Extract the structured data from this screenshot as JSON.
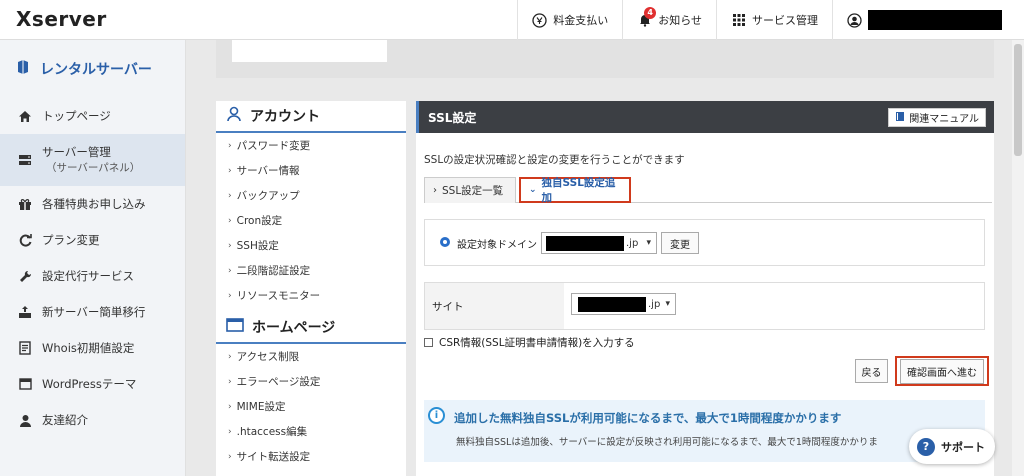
{
  "header": {
    "logo": "Xserver",
    "nav": {
      "billing": "料金支払い",
      "notice": "お知らせ",
      "notice_badge": "4",
      "service": "サービス管理"
    }
  },
  "sidebar": {
    "title": "レンタルサーバー",
    "items": [
      {
        "label": "トップページ",
        "icon": "home-icon"
      },
      {
        "label": "サーバー管理",
        "sub": "（サーバーパネル）",
        "icon": "server-icon"
      },
      {
        "label": "各種特典お申し込み",
        "icon": "gift-icon"
      },
      {
        "label": "プラン変更",
        "icon": "refresh-icon"
      },
      {
        "label": "設定代行サービス",
        "icon": "wrench-icon"
      },
      {
        "label": "新サーバー簡単移行",
        "icon": "migrate-icon"
      },
      {
        "label": "Whois初期値設定",
        "icon": "document-icon"
      },
      {
        "label": "WordPressテーマ",
        "icon": "window-icon"
      },
      {
        "label": "友達紹介",
        "icon": "person-icon"
      }
    ]
  },
  "menu": {
    "account_title": "アカウント",
    "account_items": [
      "パスワード変更",
      "サーバー情報",
      "バックアップ",
      "Cron設定",
      "SSH設定",
      "二段階認証設定",
      "リソースモニター"
    ],
    "homepage_title": "ホームページ",
    "homepage_items": [
      "アクセス制限",
      "エラーページ設定",
      "MIME設定",
      ".htaccess編集",
      "サイト転送設定"
    ]
  },
  "panel": {
    "title": "SSL設定",
    "manual_button": "関連マニュアル",
    "description": "SSLの設定状況確認と設定の変更を行うことができます",
    "tabs": [
      "SSL設定一覧",
      "独自SSL設定追加"
    ],
    "domain_label": "設定対象ドメイン",
    "domain_suffix": ".jp",
    "change_button": "変更",
    "site_label": "サイト",
    "site_suffix": ".jp",
    "csr_label": "CSR情報(SSL証明書申請情報)を入力する",
    "back_button": "戻る",
    "next_button": "確認画面へ進む",
    "info_title": "追加した無料独自SSLが利用可能になるまで、最大で1時間程度かかります",
    "info_text": "無料独自SSLは追加後、サーバーに設定が反映され利用可能になるまで、最大で1時間程度かかりま"
  },
  "support": {
    "label": "サポート"
  },
  "colors": {
    "accent_blue": "#2a5fa8",
    "highlight_red": "#d03a1c",
    "panel_header": "#3c3f44"
  }
}
